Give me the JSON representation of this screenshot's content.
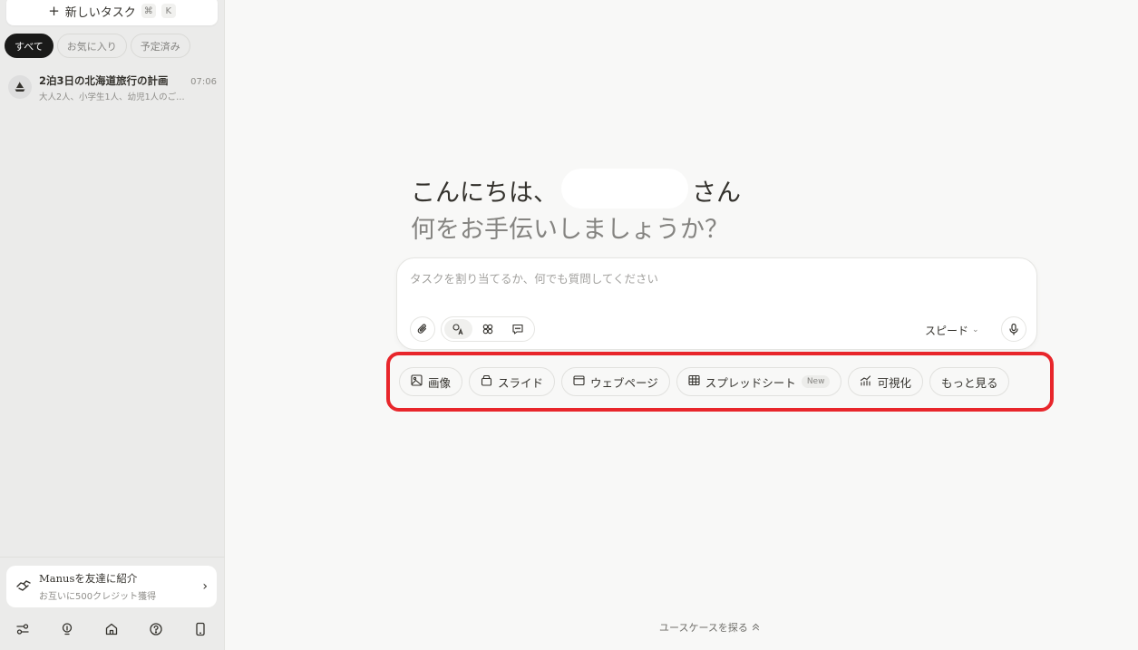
{
  "sidebar": {
    "new_task_label": "新しいタスク",
    "new_task_shortcut": [
      "⌘",
      "K"
    ],
    "filters": [
      "すべて",
      "お気に入り",
      "予定済み"
    ],
    "tasks": [
      {
        "title": "2泊3日の北海道旅行の計画",
        "time": "07:06",
        "subtitle": "大人2人、小学生1人、幼児1人のご…"
      }
    ],
    "referral": {
      "title": "Manusを友達に紹介",
      "subtitle": "お互いに500クレジット獲得"
    },
    "bottom_icons": [
      "settings-icon",
      "lightbulb-icon",
      "home-icon",
      "help-icon",
      "mobile-icon"
    ]
  },
  "main": {
    "greeting_prefix": "こんにちは、",
    "greeting_suffix": "さん",
    "greeting_line2": "何をお手伝いしましょうか？",
    "input_placeholder": "タスクを割り当てるか、何でも質問してください",
    "speed_label": "スピード",
    "quick_actions": [
      {
        "label": "画像",
        "icon": "image-icon"
      },
      {
        "label": "スライド",
        "icon": "slides-icon"
      },
      {
        "label": "ウェブページ",
        "icon": "webpage-icon"
      },
      {
        "label": "スプレッドシート",
        "icon": "spreadsheet-icon",
        "badge": "New"
      },
      {
        "label": "可視化",
        "icon": "chart-icon"
      },
      {
        "label": "もっと見る",
        "icon": ""
      }
    ],
    "explore_label": "ユースケースを探る"
  },
  "colors": {
    "highlight": "#e8262b",
    "sidebar_bg": "#ebebea",
    "main_bg": "#f8f8f7",
    "active_chip": "#1a1a19"
  }
}
